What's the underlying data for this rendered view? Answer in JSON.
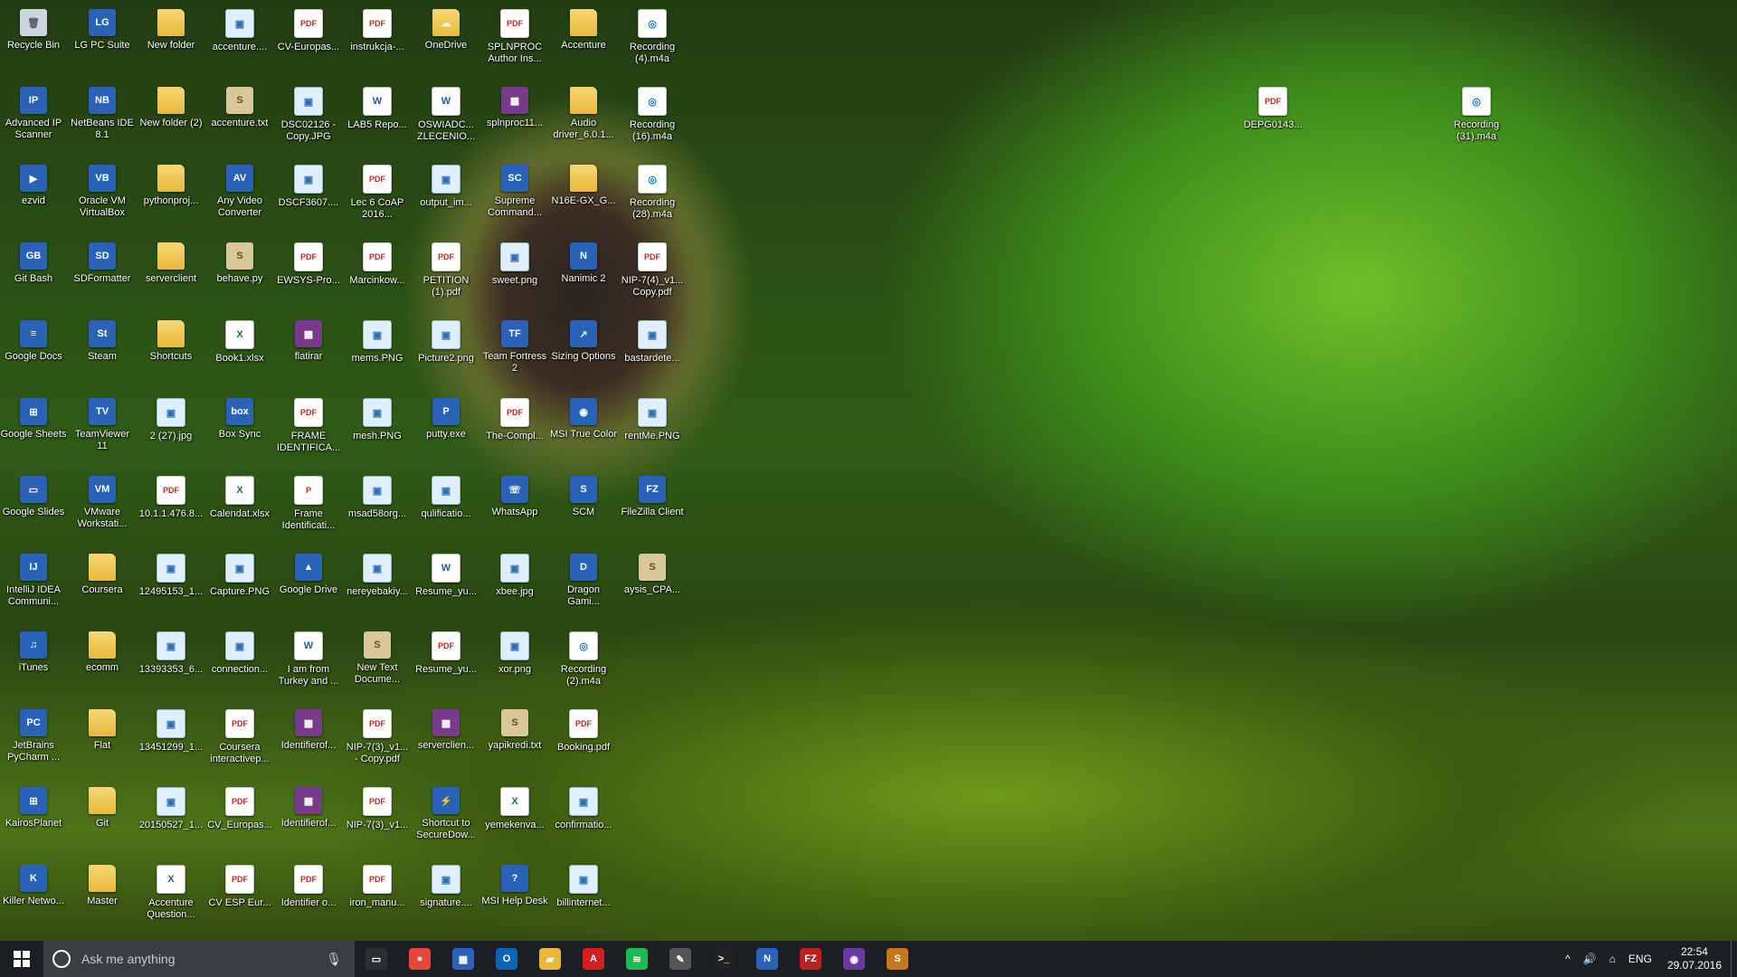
{
  "desktop": {
    "icons": [
      [
        "Recycle Bin",
        "bin",
        "🗑"
      ],
      [
        "LG PC Suite",
        "app",
        "LG"
      ],
      [
        "New folder",
        "folder",
        ""
      ],
      [
        "accenture....",
        "img",
        "▣"
      ],
      [
        "CV-Europas...",
        "pdf",
        "PDF"
      ],
      [
        "instrukcja-...",
        "pdf",
        "PDF"
      ],
      [
        "OneDrive",
        "folder",
        "☁"
      ],
      [
        "SPLNPROC Author Ins...",
        "pdf",
        "PDF"
      ],
      [
        "Accenture",
        "folder",
        ""
      ],
      [
        "Recording (4).m4a",
        "rec",
        "◎"
      ],
      [
        "Advanced IP Scanner",
        "app",
        "IP"
      ],
      [
        "NetBeans IDE 8.1",
        "app",
        "NB"
      ],
      [
        "New folder (2)",
        "folder",
        ""
      ],
      [
        "accenture.txt",
        "txt",
        "S"
      ],
      [
        "DSC02126 - Copy.JPG",
        "img",
        "▣"
      ],
      [
        "LAB5 Repo...",
        "doc",
        "W"
      ],
      [
        "OSWIADC... ZLECENIO...",
        "doc",
        "W"
      ],
      [
        "splnproc11...",
        "rar",
        "▦"
      ],
      [
        "Audio driver_6.0.1...",
        "folder",
        ""
      ],
      [
        "Recording (16).m4a",
        "rec",
        "◎"
      ],
      [
        "ezvid",
        "app",
        "▶"
      ],
      [
        "Oracle VM VirtualBox",
        "app",
        "VB"
      ],
      [
        "pythonproj...",
        "folder",
        ""
      ],
      [
        "Any Video Converter",
        "app",
        "AV"
      ],
      [
        "DSCF3607....",
        "img",
        "▣"
      ],
      [
        "Lec 6 CoAP 2016...",
        "pdf",
        "PDF"
      ],
      [
        "output_im...",
        "img",
        "▣"
      ],
      [
        "Supreme Command...",
        "app",
        "SC"
      ],
      [
        "N16E-GX_G...",
        "folder",
        ""
      ],
      [
        "Recording (28).m4a",
        "rec",
        "◎"
      ],
      [
        "Git Bash",
        "app",
        "GB"
      ],
      [
        "SDFormatter",
        "app",
        "SD"
      ],
      [
        "serverclient",
        "folder",
        ""
      ],
      [
        "behave.py",
        "txt",
        "S"
      ],
      [
        "EWSYS-Pro...",
        "pdf",
        "PDF"
      ],
      [
        "Marcinkow...",
        "pdf",
        "PDF"
      ],
      [
        "PETITION (1).pdf",
        "pdf",
        "PDF"
      ],
      [
        "sweet.png",
        "img",
        "▣"
      ],
      [
        "Nanimic 2",
        "app",
        "N"
      ],
      [
        "NIP-7(4)_v1... Copy.pdf",
        "pdf",
        "PDF"
      ],
      [
        "Google Docs",
        "app",
        "≡"
      ],
      [
        "Steam",
        "app",
        "St"
      ],
      [
        "Shortcuts",
        "folder",
        ""
      ],
      [
        "Book1.xlsx",
        "xls",
        "X"
      ],
      [
        "flatirar",
        "rar",
        "▦"
      ],
      [
        "mems.PNG",
        "img",
        "▣"
      ],
      [
        "Picture2.png",
        "img",
        "▣"
      ],
      [
        "Team Fortress 2",
        "app",
        "TF"
      ],
      [
        "Sizing Options",
        "app",
        "↗"
      ],
      [
        "bastardete...",
        "img",
        "▣"
      ],
      [
        "Google Sheets",
        "app",
        "⊞"
      ],
      [
        "TeamViewer 11",
        "app",
        "TV"
      ],
      [
        "2 (27).jpg",
        "img",
        "▣"
      ],
      [
        "Box Sync",
        "app",
        "box"
      ],
      [
        "FRAME IDENTIFICA...",
        "pdf",
        "PDF"
      ],
      [
        "mesh.PNG",
        "img",
        "▣"
      ],
      [
        "putty.exe",
        "app",
        "P"
      ],
      [
        "The-Compl...",
        "pdf",
        "PDF"
      ],
      [
        "MSI True Color",
        "app",
        "◉"
      ],
      [
        "rentMe.PNG",
        "img",
        "▣"
      ],
      [
        "Google Slides",
        "app",
        "▭"
      ],
      [
        "VMware Workstati...",
        "app",
        "VM"
      ],
      [
        "10.1.1.476.8...",
        "pdf",
        "PDF"
      ],
      [
        "Calendat.xlsx",
        "xls",
        "X"
      ],
      [
        "Frame Identificati...",
        "pdf",
        "P"
      ],
      [
        "msad58org...",
        "img",
        "▣"
      ],
      [
        "qulificatio...",
        "img",
        "▣"
      ],
      [
        "WhatsApp",
        "app",
        "☏"
      ],
      [
        "SCM",
        "app",
        "S"
      ],
      [
        "FileZilla Client",
        "app",
        "FZ"
      ],
      [
        "IntelliJ IDEA Communi...",
        "app",
        "IJ"
      ],
      [
        "Coursera",
        "folder",
        ""
      ],
      [
        "12495153_1...",
        "img",
        "▣"
      ],
      [
        "Capture.PNG",
        "img",
        "▣"
      ],
      [
        "Google Drive",
        "app",
        "▲"
      ],
      [
        "nereyebakiy...",
        "img",
        "▣"
      ],
      [
        "Resume_yu...",
        "doc",
        "W"
      ],
      [
        "xbee.jpg",
        "img",
        "▣"
      ],
      [
        "Dragon Gami...",
        "app",
        "D"
      ],
      [
        "aysis_CPA...",
        "txt",
        "S"
      ],
      [
        "iTunes",
        "app",
        "♫"
      ],
      [
        "ecomm",
        "folder",
        ""
      ],
      [
        "13393353_6...",
        "img",
        "▣"
      ],
      [
        "connection...",
        "img",
        "▣"
      ],
      [
        "I am from Turkey and ...",
        "doc",
        "W"
      ],
      [
        "New Text Docume...",
        "txt",
        "S"
      ],
      [
        "Resume_yu...",
        "pdf",
        "PDF"
      ],
      [
        "xor.png",
        "img",
        "▣"
      ],
      [
        "Recording (2).m4a",
        "rec",
        "◎"
      ],
      [
        "JetBrains PyCharm ...",
        "app",
        "PC"
      ],
      [
        "Flat",
        "folder",
        ""
      ],
      [
        "13451299_1...",
        "img",
        "▣"
      ],
      [
        "Coursera interactivep...",
        "pdf",
        "PDF"
      ],
      [
        "Identifierof...",
        "rar",
        "▦"
      ],
      [
        "NIP-7(3)_v1... - Copy.pdf",
        "pdf",
        "PDF"
      ],
      [
        "serverclien...",
        "rar",
        "▦"
      ],
      [
        "yapikredi.txt",
        "txt",
        "S"
      ],
      [
        "Booking.pdf",
        "pdf",
        "PDF"
      ],
      [
        "KairosPlanet",
        "app",
        "⊞"
      ],
      [
        "Git",
        "folder",
        ""
      ],
      [
        "20150527_1...",
        "img",
        "▣"
      ],
      [
        "CV_Europas...",
        "pdf",
        "PDF"
      ],
      [
        "Identifierof...",
        "rar",
        "▦"
      ],
      [
        "NIP-7(3)_v1...",
        "pdf",
        "PDF"
      ],
      [
        "Shortcut to SecureDow...",
        "app",
        "⚡"
      ],
      [
        "yemekenva...",
        "xls",
        "X"
      ],
      [
        "confirmatio...",
        "img",
        "▣"
      ],
      [
        "Killer Netwo...",
        "app",
        "K"
      ],
      [
        "Master",
        "folder",
        ""
      ],
      [
        "Accenture Question...",
        "xls",
        "X"
      ],
      [
        "CV ESP Eur...",
        "pdf",
        "PDF"
      ],
      [
        "Identifier o...",
        "pdf",
        "PDF"
      ],
      [
        "iron_manu...",
        "pdf",
        "PDF"
      ],
      [
        "signature....",
        "img",
        "▣"
      ],
      [
        "MSI Help Desk",
        "app",
        "?"
      ],
      [
        "billinternet...",
        "img",
        "▣"
      ],
      [
        "DEPG0143...",
        "pdf",
        "PDF"
      ],
      [
        "Recording (31).m4a",
        "rec",
        "◎"
      ]
    ]
  },
  "taskbar": {
    "search_placeholder": "Ask me anything",
    "apps": [
      [
        "task-view",
        "#2b2f35",
        "▭"
      ],
      [
        "chrome",
        "#e8453c",
        "●"
      ],
      [
        "store",
        "#2a62b8",
        "▦"
      ],
      [
        "outlook",
        "#0a64b4",
        "O"
      ],
      [
        "explorer",
        "#e9b83a",
        "▰"
      ],
      [
        "acrobat",
        "#d21f1f",
        "A"
      ],
      [
        "spotify",
        "#1db954",
        "≋"
      ],
      [
        "paint",
        "#555",
        "✎"
      ],
      [
        "cmd",
        "#222",
        ">_"
      ],
      [
        "nanimic",
        "#2a62b8",
        "N"
      ],
      [
        "filezilla",
        "#bf1e1e",
        "FZ"
      ],
      [
        "truecolor",
        "#6a3aa0",
        "◉"
      ],
      [
        "sublime",
        "#c9761a",
        "S"
      ]
    ],
    "tray": {
      "chevron": "^",
      "volume": "🔊",
      "network": "⌂",
      "lang": "ENG",
      "time": "22:54",
      "date": "29.07.2016"
    }
  }
}
